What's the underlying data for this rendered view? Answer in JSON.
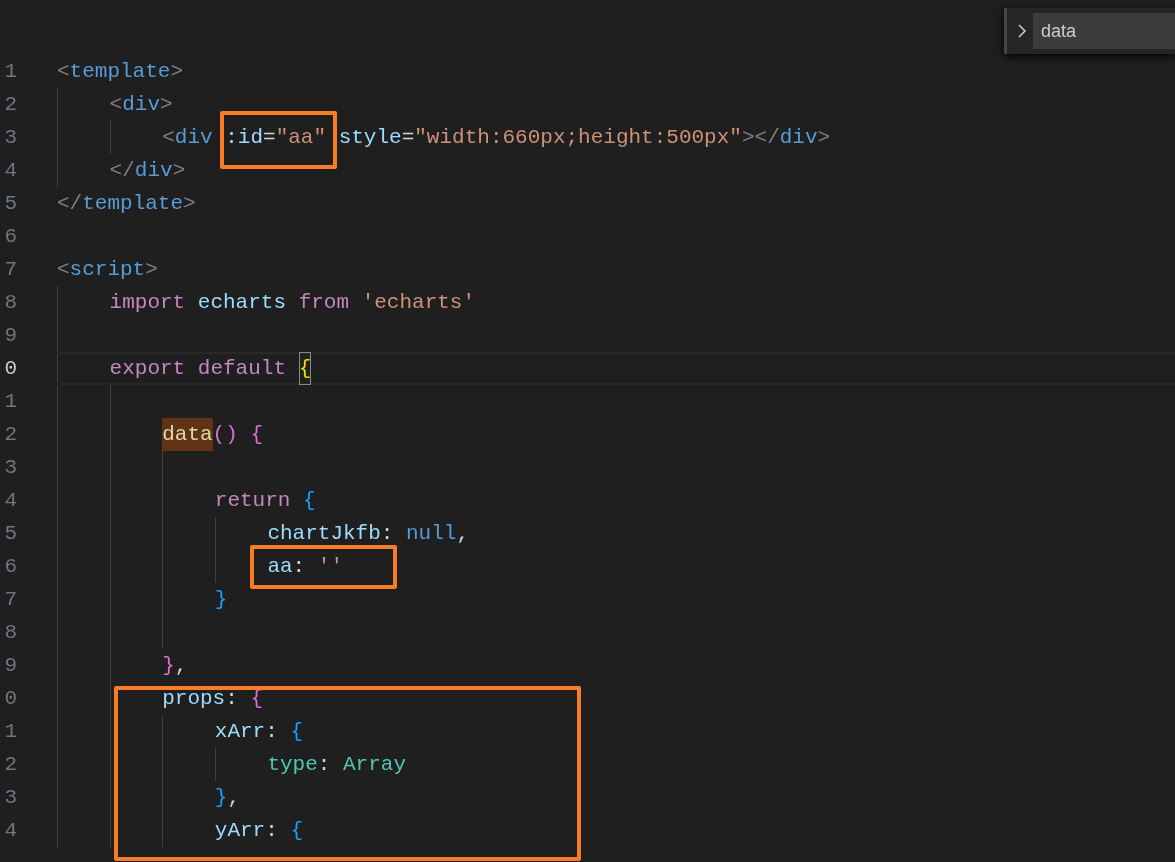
{
  "find_widget": {
    "value": "data",
    "expanded": false
  },
  "lines": [
    {
      "number": "1",
      "current": false,
      "tokens": [
        {
          "text": "<",
          "kind": "punct"
        },
        {
          "text": "template",
          "kind": "tag"
        },
        {
          "text": ">",
          "kind": "punct"
        }
      ]
    },
    {
      "number": "2",
      "current": false,
      "tokens": [
        {
          "text": "<",
          "kind": "punct"
        },
        {
          "text": "div",
          "kind": "tag"
        },
        {
          "text": ">",
          "kind": "punct"
        }
      ]
    },
    {
      "number": "3",
      "current": false,
      "tokens": [
        {
          "text": "<",
          "kind": "punct"
        },
        {
          "text": "div",
          "kind": "tag"
        },
        {
          "text": ":id",
          "kind": "attr",
          "sp": true
        },
        {
          "text": "=",
          "kind": "op"
        },
        {
          "text": "\"aa\"",
          "kind": "string"
        },
        {
          "text": "style",
          "kind": "attr",
          "sp": true
        },
        {
          "text": "=",
          "kind": "op"
        },
        {
          "text": "\"width:660px;height:500px\"",
          "kind": "string"
        },
        {
          "text": ">",
          "kind": "punct"
        },
        {
          "text": "</",
          "kind": "punct"
        },
        {
          "text": "div",
          "kind": "tag"
        },
        {
          "text": ">",
          "kind": "punct"
        }
      ]
    },
    {
      "number": "4",
      "current": false,
      "tokens": [
        {
          "text": "</",
          "kind": "punct"
        },
        {
          "text": "div",
          "kind": "tag"
        },
        {
          "text": ">",
          "kind": "punct"
        }
      ]
    },
    {
      "number": "5",
      "current": false,
      "tokens": [
        {
          "text": "</",
          "kind": "punct"
        },
        {
          "text": "template",
          "kind": "tag"
        },
        {
          "text": ">",
          "kind": "punct"
        }
      ]
    },
    {
      "number": "6",
      "current": false
    },
    {
      "number": "7",
      "current": false,
      "tokens": [
        {
          "text": "<",
          "kind": "punct"
        },
        {
          "text": "script",
          "kind": "tag"
        },
        {
          "text": ">",
          "kind": "punct"
        }
      ]
    },
    {
      "number": "8",
      "current": false,
      "tokens": [
        {
          "text": "import",
          "kind": "keyword"
        },
        {
          "text": "echarts",
          "kind": "variable",
          "sp": true
        },
        {
          "text": "from",
          "kind": "keyword",
          "sp": true
        },
        {
          "text": "'echarts'",
          "kind": "string",
          "sp": true
        }
      ]
    },
    {
      "number": "9",
      "current": false
    },
    {
      "number": "0",
      "current": true,
      "tokens": [
        {
          "text": "export",
          "kind": "keyword"
        },
        {
          "text": "default",
          "kind": "keyword",
          "sp": true
        },
        {
          "text": "{",
          "kind": "brace1",
          "sp": true,
          "bracket_match": true
        }
      ]
    },
    {
      "number": "1",
      "current": false
    },
    {
      "number": "2",
      "current": false,
      "tokens": [
        {
          "text": "data",
          "kind": "function",
          "find_match": true
        },
        {
          "text": "()",
          "kind": "brace2"
        },
        {
          "text": "{",
          "kind": "brace2",
          "sp": true
        }
      ]
    },
    {
      "number": "3",
      "current": false
    },
    {
      "number": "4",
      "current": false,
      "tokens": [
        {
          "text": "return",
          "kind": "keyword"
        },
        {
          "text": "{",
          "kind": "brace3",
          "sp": true
        }
      ]
    },
    {
      "number": "5",
      "current": false,
      "tokens": [
        {
          "text": "chartJkfb",
          "kind": "variable"
        },
        {
          "text": ":",
          "kind": "op"
        },
        {
          "text": "null",
          "kind": "constant",
          "sp": true
        },
        {
          "text": ",",
          "kind": "op"
        }
      ]
    },
    {
      "number": "6",
      "current": false,
      "tokens": [
        {
          "text": "aa",
          "kind": "variable"
        },
        {
          "text": ":",
          "kind": "op"
        },
        {
          "text": "''",
          "kind": "string",
          "sp": true
        }
      ]
    },
    {
      "number": "7",
      "current": false,
      "tokens": [
        {
          "text": "}",
          "kind": "brace3"
        }
      ]
    },
    {
      "number": "8",
      "current": false
    },
    {
      "number": "9",
      "current": false,
      "tokens": [
        {
          "text": "}",
          "kind": "brace2"
        },
        {
          "text": ",",
          "kind": "op"
        }
      ]
    },
    {
      "number": "0",
      "current": false,
      "tokens": [
        {
          "text": "props",
          "kind": "variable"
        },
        {
          "text": ":",
          "kind": "op"
        },
        {
          "text": "{",
          "kind": "brace2",
          "sp": true
        }
      ]
    },
    {
      "number": "1",
      "current": false,
      "tokens": [
        {
          "text": "xArr",
          "kind": "variable"
        },
        {
          "text": ":",
          "kind": "op"
        },
        {
          "text": "{",
          "kind": "brace3",
          "sp": true
        }
      ]
    },
    {
      "number": "2",
      "current": false,
      "tokens": [
        {
          "text": "type",
          "kind": "type"
        },
        {
          "text": ":",
          "kind": "op"
        },
        {
          "text": "Array",
          "kind": "type",
          "sp": true
        }
      ]
    },
    {
      "number": "3",
      "current": false,
      "tokens": [
        {
          "text": "}",
          "kind": "brace3"
        },
        {
          "text": ",",
          "kind": "op"
        }
      ]
    },
    {
      "number": "4",
      "current": false,
      "tokens": [
        {
          "text": "yArr",
          "kind": "variable"
        },
        {
          "text": ":",
          "kind": "op"
        },
        {
          "text": "{",
          "kind": "brace3",
          "sp": true
        }
      ]
    }
  ]
}
